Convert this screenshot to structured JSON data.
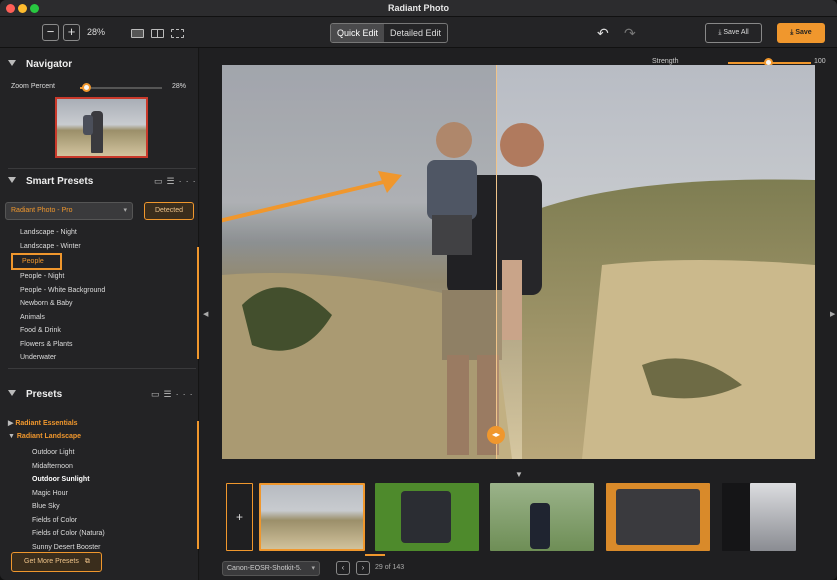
{
  "app": {
    "title": "Radiant Photo"
  },
  "toolbar": {
    "zoom_minus": "−",
    "zoom_plus": "+",
    "zoom_value": "28%",
    "edit_modes": [
      {
        "label": "Quick Edit",
        "active": true
      },
      {
        "label": "Detailed Edit",
        "active": false
      }
    ],
    "save_all_label": "Save All",
    "save_label": "Save",
    "accent_color": "#f0972d"
  },
  "navigator": {
    "title": "Navigator",
    "zoom_label": "Zoom Percent",
    "zoom_value": "28%",
    "zoom_fraction": 0.28
  },
  "smart_presets": {
    "title": "Smart Presets",
    "dropdown_value": "Radiant Photo - Pro",
    "detected_label": "Detected",
    "items": [
      "Landscape - Night",
      "Landscape - Winter",
      "People",
      "People - Night",
      "People - White Background",
      "Newborn & Baby",
      "Animals",
      "Food & Drink",
      "Flowers & Plants",
      "Underwater"
    ],
    "selected": "People"
  },
  "presets": {
    "title": "Presets",
    "groups": [
      {
        "label": "Radiant Essentials",
        "expanded": false
      },
      {
        "label": "Radiant Landscape",
        "expanded": true
      }
    ],
    "items": [
      "Outdoor Light",
      "Midafternoon",
      "Outdoor Sunlight",
      "Magic Hour",
      "Blue Sky",
      "Fields of Color",
      "Fields of Color (Natura)",
      "Sunny Desert Booster"
    ],
    "get_more_label": "Get More Presets"
  },
  "strength": {
    "label": "Strength",
    "value": "100",
    "fraction": 1.0
  },
  "filmstrip": {
    "add_label": "+",
    "file_select": "Canon-EOSR-Shotkit-5.",
    "page_counter": "29 of 143"
  }
}
